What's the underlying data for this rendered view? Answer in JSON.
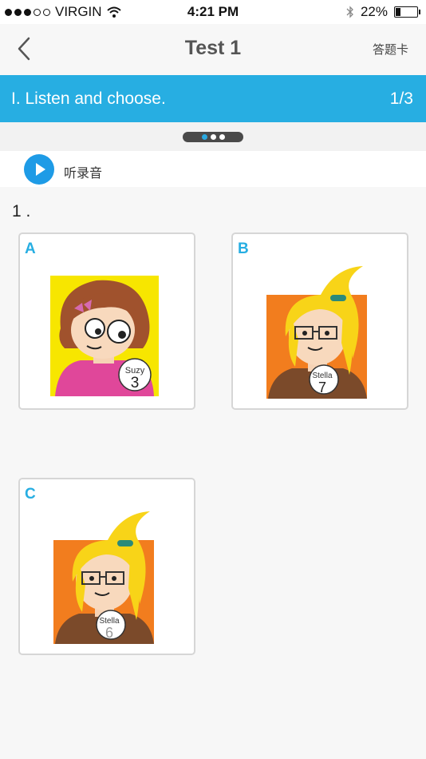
{
  "status_bar": {
    "carrier": "VIRGIN",
    "time": "4:21 PM",
    "battery_percent": "22%",
    "battery_level": 0.22
  },
  "nav": {
    "title": "Test 1",
    "answer_card": "答题卡"
  },
  "section": {
    "title": "I. Listen and choose.",
    "count": "1/3"
  },
  "audio": {
    "label": "听录音"
  },
  "question": {
    "number": "1 .",
    "options": [
      {
        "letter": "A",
        "badge_name": "Suzy",
        "badge_number": "3"
      },
      {
        "letter": "B",
        "badge_name": "Stella",
        "badge_number": "7"
      },
      {
        "letter": "C",
        "badge_name": "Stella",
        "badge_number": "6"
      }
    ]
  },
  "colors": {
    "accent": "#27aee2",
    "play_button": "#1e9be6"
  }
}
